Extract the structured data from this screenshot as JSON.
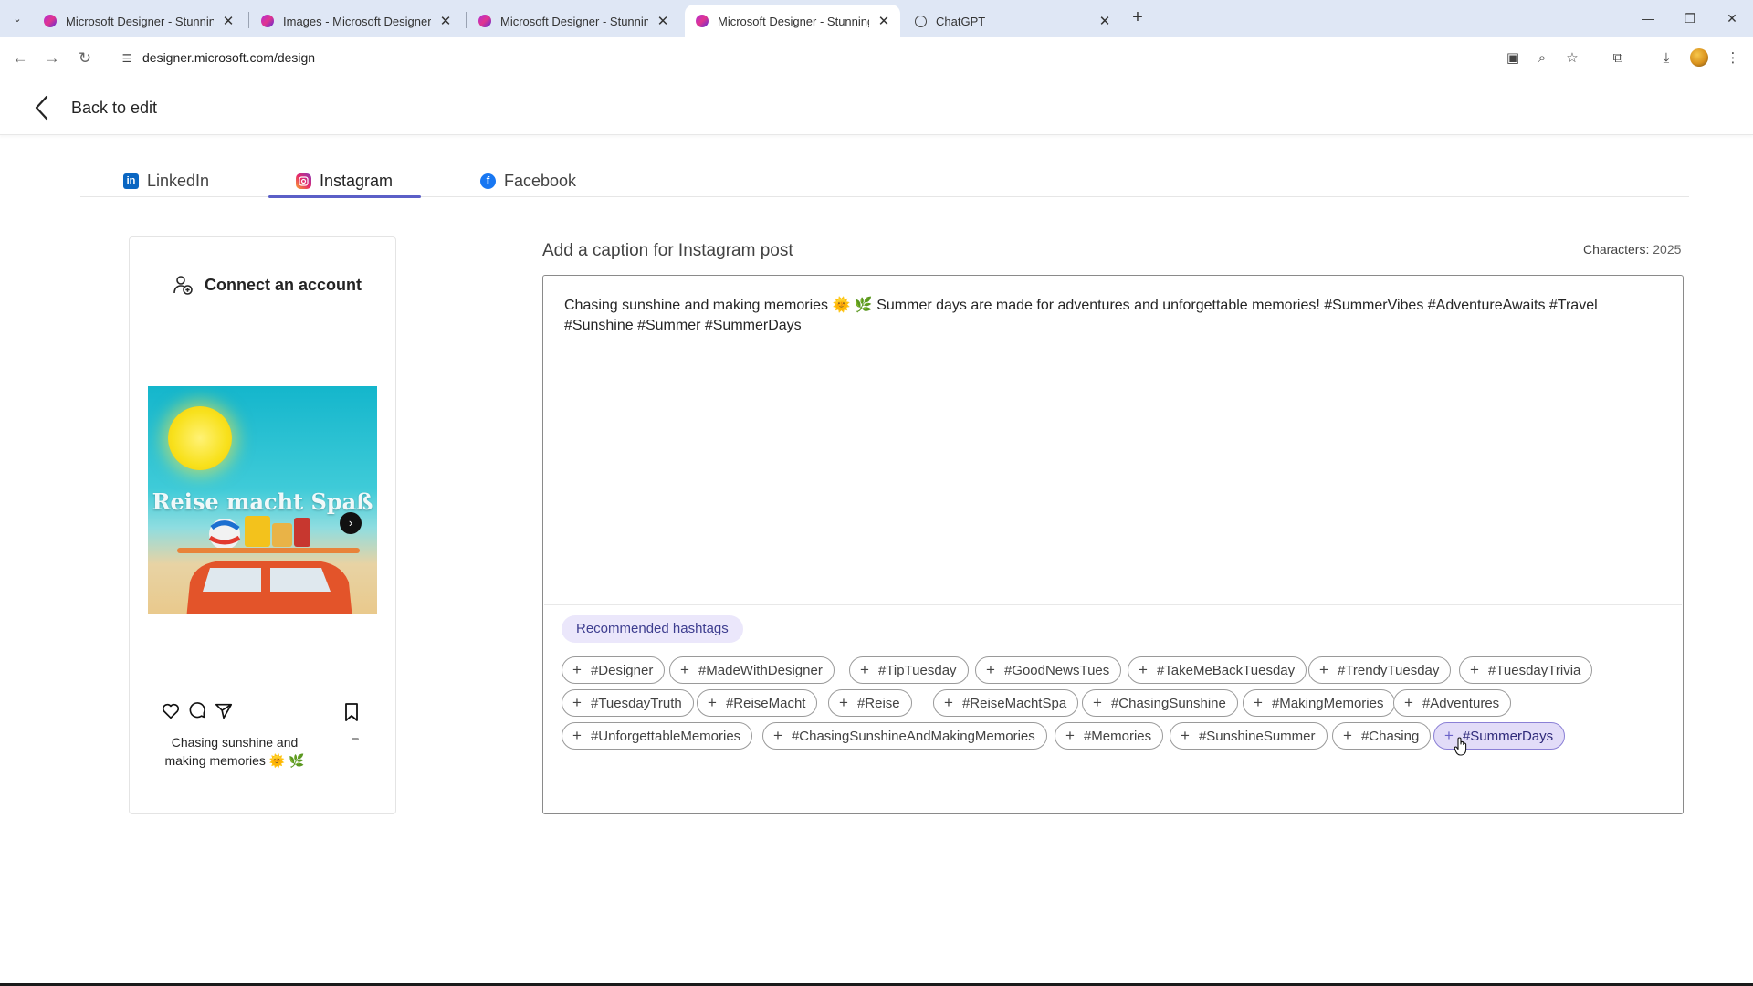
{
  "browser": {
    "tabs": [
      {
        "title": "Microsoft Designer - Stunning d",
        "favicon": "designer-icon"
      },
      {
        "title": "Images - Microsoft Designer",
        "favicon": "designer-icon"
      },
      {
        "title": "Microsoft Designer - Stunning d",
        "favicon": "designer-icon"
      },
      {
        "title": "Microsoft Designer - Stunning d",
        "favicon": "designer-icon",
        "active": true
      },
      {
        "title": "ChatGPT",
        "favicon": "chatgpt-icon"
      }
    ],
    "url": "designer.microsoft.com/design"
  },
  "header": {
    "back_label": "Back to edit"
  },
  "platform_tabs": [
    {
      "label": "LinkedIn",
      "icon": "linkedin-icon"
    },
    {
      "label": "Instagram",
      "icon": "instagram-icon",
      "active": true
    },
    {
      "label": "Facebook",
      "icon": "facebook-icon"
    }
  ],
  "preview": {
    "connect_label": "Connect an account",
    "image_text": "Reise macht Spaß",
    "caption": "Chasing sunshine and making memories 🌞 🌿"
  },
  "caption_editor": {
    "label": "Add a caption for Instagram post",
    "characters_label": "Characters:",
    "characters_count": "2025",
    "text": "Chasing sunshine and making memories 🌞 🌿  Summer days are made for adventures and unforgettable memories! #SummerVibes #AdventureAwaits #Travel #Sunshine #Summer  #SummerDays",
    "recommended_label": "Recommended hashtags",
    "hashtags": [
      [
        "#Designer",
        "#MadeWithDesigner",
        "#TipTuesday",
        "#GoodNewsTues",
        "#TakeMeBackTuesday",
        "#TrendyTuesday",
        "#TuesdayTrivia"
      ],
      [
        "#TuesdayTruth",
        "#ReiseMacht",
        "#Reise",
        "#ReiseMachtSpa",
        "#ChasingSunshine",
        "#MakingMemories",
        "#Adventures"
      ],
      [
        "#UnforgettableMemories",
        "#ChasingSunshineAndMakingMemories",
        "#Memories",
        "#SunshineSummer",
        "#Chasing",
        "#SummerDays"
      ]
    ],
    "selected_hashtag": "#SummerDays"
  },
  "colors": {
    "accent": "#5b5fc7",
    "linkedin": "#0a66c2",
    "facebook": "#1877f2",
    "selected_tag_bg": "#e2dcf8"
  }
}
